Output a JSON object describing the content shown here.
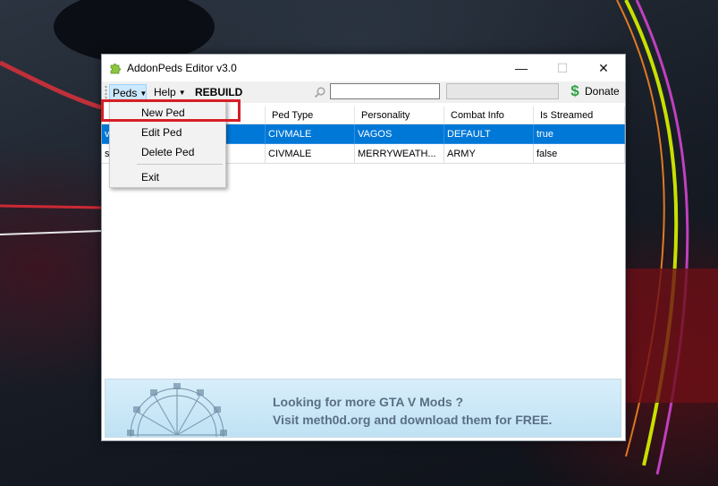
{
  "window": {
    "title": "AddonPeds Editor v3.0"
  },
  "toolbar": {
    "peds_label": "Peds",
    "help_label": "Help",
    "rebuild_label": "REBUILD",
    "search_value": "",
    "donate_label": "Donate"
  },
  "icons": {
    "app": "puzzle-icon",
    "search": "search-icon",
    "donate": "dollar-icon",
    "minimize": "minimize-icon",
    "maximize": "maximize-icon",
    "close": "close-icon"
  },
  "table": {
    "columns": [
      "Ped Type",
      "Personality",
      "Combat Info",
      "Is Streamed"
    ],
    "rows": [
      {
        "name": "v",
        "ped_type": "CIVMALE",
        "personality": "VAGOS",
        "combat": "DEFAULT",
        "streamed": "true",
        "selected": true
      },
      {
        "name": "s",
        "ped_type": "CIVMALE",
        "personality": "MERRYWEATH...",
        "combat": "ARMY",
        "streamed": "false",
        "selected": false
      }
    ]
  },
  "menu": {
    "items": [
      "New Ped",
      "Edit Ped",
      "Delete Ped",
      "Exit"
    ]
  },
  "banner": {
    "line1": "Looking for more GTA V Mods ?",
    "line2": "Visit meth0d.org and download them for FREE."
  },
  "colors": {
    "selection": "#0078d7",
    "highlight_border": "#d61f26",
    "donate_green": "#2ea043",
    "banner_text": "#5b6f84"
  }
}
